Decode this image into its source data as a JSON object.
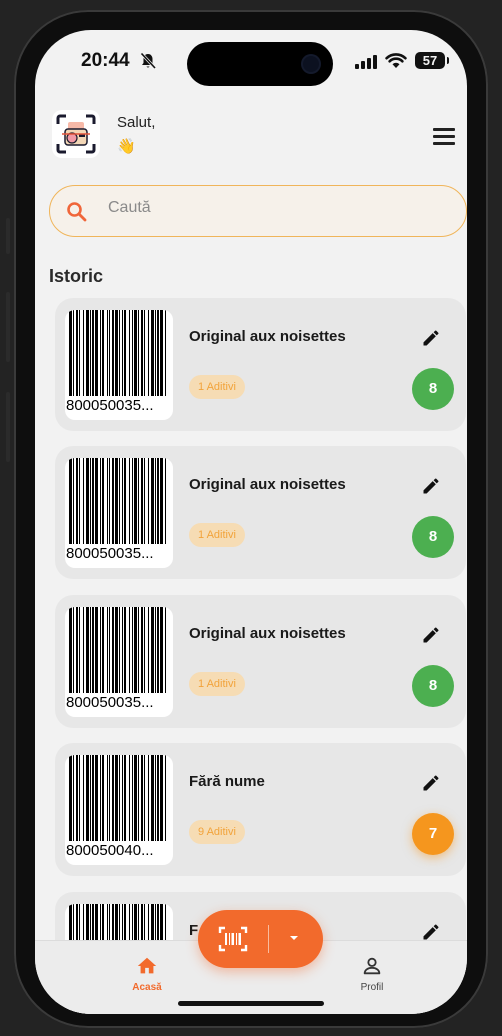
{
  "status_bar": {
    "time": "20:44",
    "battery": "57",
    "battery_level": 0.57
  },
  "header": {
    "greeting": "Salut,",
    "wave": "👋"
  },
  "search": {
    "placeholder": "Caută"
  },
  "history": {
    "title": "Istoric",
    "items": [
      {
        "barcode": "800050035...",
        "name": "Original aux noisettes",
        "additives": "1 Aditivi",
        "score": "8",
        "score_color": "#4caf50"
      },
      {
        "barcode": "800050035...",
        "name": "Original aux noisettes",
        "additives": "1 Aditivi",
        "score": "8",
        "score_color": "#4caf50"
      },
      {
        "barcode": "800050035...",
        "name": "Original aux noisettes",
        "additives": "1 Aditivi",
        "score": "8",
        "score_color": "#4caf50"
      },
      {
        "barcode": "800050040...",
        "name": "Fără nume",
        "additives": "9 Aditivi",
        "score": "7",
        "score_color": "#f5961e"
      },
      {
        "barcode": "",
        "name": "F",
        "additives": "",
        "score": "",
        "score_color": ""
      }
    ]
  },
  "nav": {
    "home": "Acasă",
    "profile": "Profil",
    "accent": "#f26a2c"
  },
  "icons": {
    "status": "bell-slash-icon",
    "menu": "menu-icon",
    "search": "search-icon",
    "edit": "pencil-icon",
    "scan": "barcode-scan-icon",
    "home": "home-icon",
    "profile": "user-icon"
  }
}
